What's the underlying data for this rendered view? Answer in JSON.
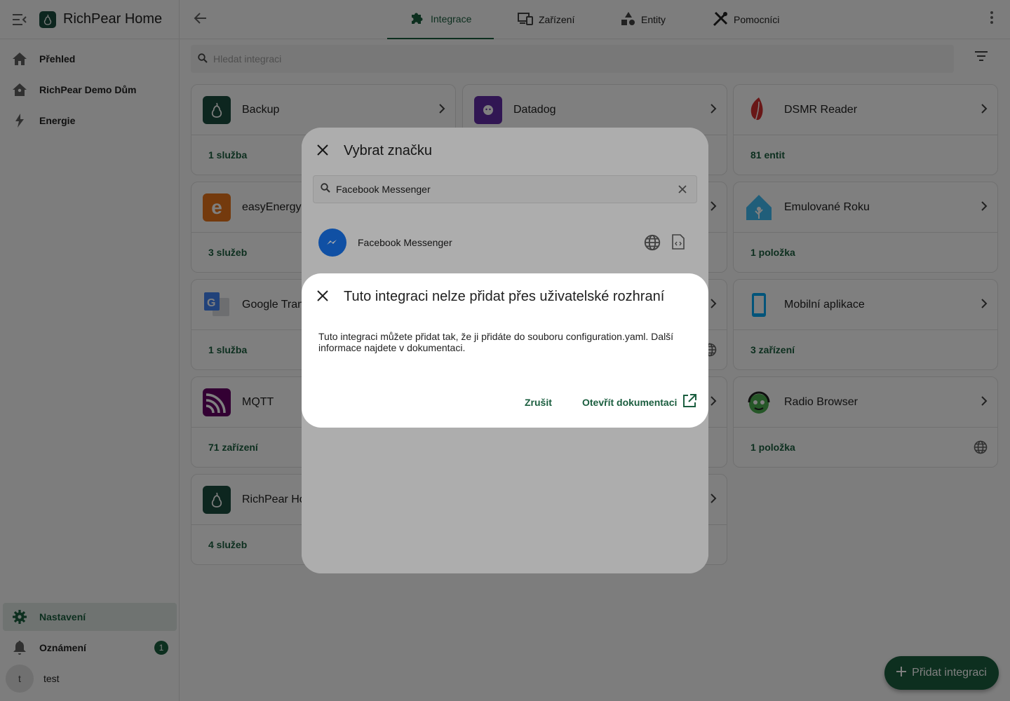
{
  "sidebar": {
    "title": "RichPear Home",
    "items": [
      {
        "label": "Přehled"
      },
      {
        "label": "RichPear Demo Dům"
      },
      {
        "label": "Energie"
      }
    ],
    "settings_label": "Nastavení",
    "notifications_label": "Oznámení",
    "notifications_count": "1",
    "user_initial": "t",
    "user_name": "test"
  },
  "tabs": [
    {
      "label": "Integrace",
      "active": true
    },
    {
      "label": "Zařízení"
    },
    {
      "label": "Entity"
    },
    {
      "label": "Pomocníci"
    }
  ],
  "search": {
    "placeholder": "Hledat integraci"
  },
  "cards": [
    {
      "name": "Backup",
      "link": "1 služba"
    },
    {
      "name": "Datadog",
      "link": ""
    },
    {
      "name": "DSMR Reader",
      "link": "81 entit"
    },
    {
      "name": "easyEnergy",
      "link": "3 služeb"
    },
    {
      "name": "Emulované Roku",
      "link": "1 položka"
    },
    {
      "name": "Google Tran",
      "link": "1 služba"
    },
    {
      "name": "Mobilní aplikace",
      "link": "3 zařízení"
    },
    {
      "name": "MQTT",
      "link": "71 zařízení"
    },
    {
      "name": "Radio Browser",
      "link": "1 položka"
    },
    {
      "name": "RichPear Ho",
      "link": "4 služeb"
    }
  ],
  "fab": {
    "label": "Přidat integraci"
  },
  "brand_dialog": {
    "title": "Vybrat značku",
    "search_value": "Facebook Messenger",
    "result_name": "Facebook Messenger"
  },
  "alert_dialog": {
    "title": "Tuto integraci nelze přidat přes uživatelské rozhraní",
    "text": "Tuto integraci můžete přidat tak, že ji přidáte do souboru configuration.yaml. Další informace najdete v dokumentaci.",
    "cancel_label": "Zrušit",
    "open_docs_label": "Otevřít dokumentaci"
  },
  "colors": {
    "accent": "#1b5e3f",
    "scrim": "rgba(0,0,0,0.5)"
  }
}
